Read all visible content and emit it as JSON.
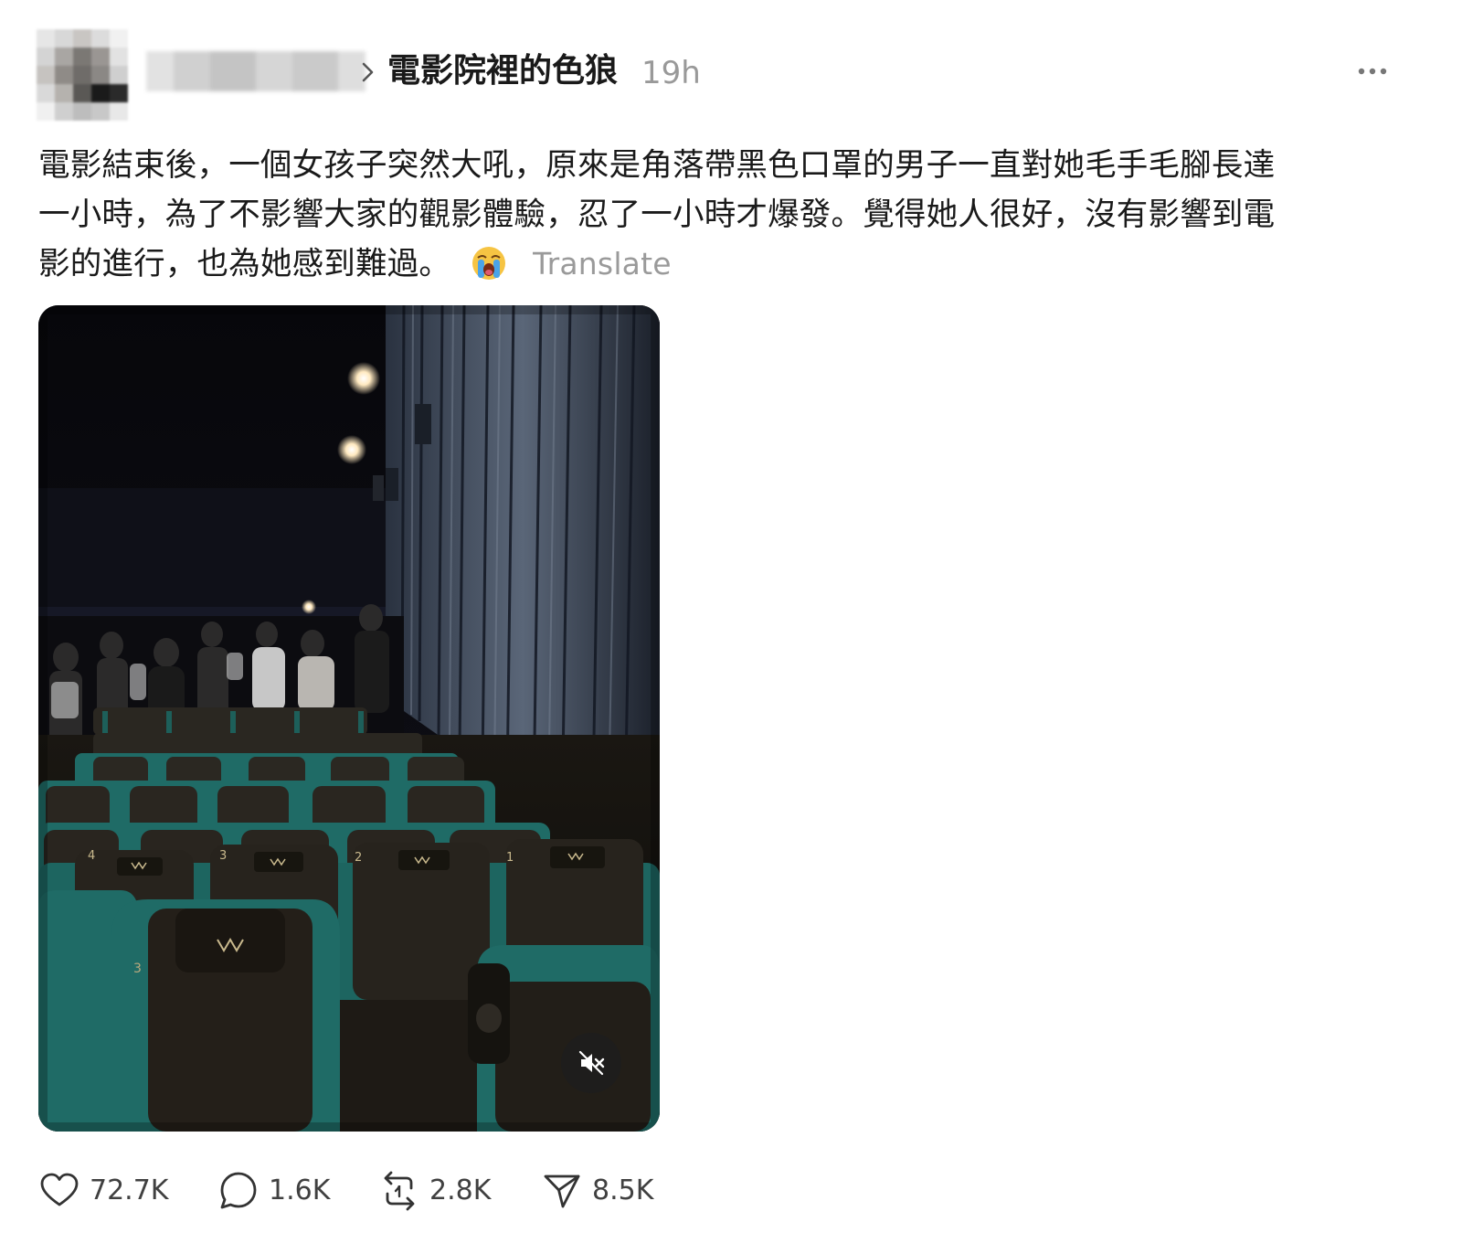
{
  "post": {
    "group_name": "電影院裡的色狼",
    "timestamp": "19h",
    "text_lines": [
      "電影結束後，一個女孩子突然大吼，原來是角落帶黑色口罩的男子一直對她毛手毛腳長達",
      "一小時，為了不影響大家的觀影體驗，忍了一小時才爆發。覺得她人很好，沒有影響到電",
      "影的進行，也為她感到難過。"
    ],
    "emoji": "crying-face-emoji",
    "translate_label": "Translate",
    "media": {
      "type": "video",
      "muted": true,
      "seat_numbers": [
        "4",
        "3",
        "2",
        "1",
        "3"
      ]
    }
  },
  "actions": {
    "like_count": "72.7K",
    "reply_count": "1.6K",
    "repost_count": "2.8K",
    "share_count": "8.5K"
  },
  "icons": {
    "like": "heart-icon",
    "reply": "comment-icon",
    "repost": "repost-icon",
    "share": "send-icon",
    "more": "more-dots-icon",
    "mute": "speaker-muted-icon",
    "chevron": "chevron-right-icon"
  },
  "colors": {
    "text": "#1a1a1a",
    "muted_text": "#999999",
    "seat_teal": "#1f6b66"
  }
}
